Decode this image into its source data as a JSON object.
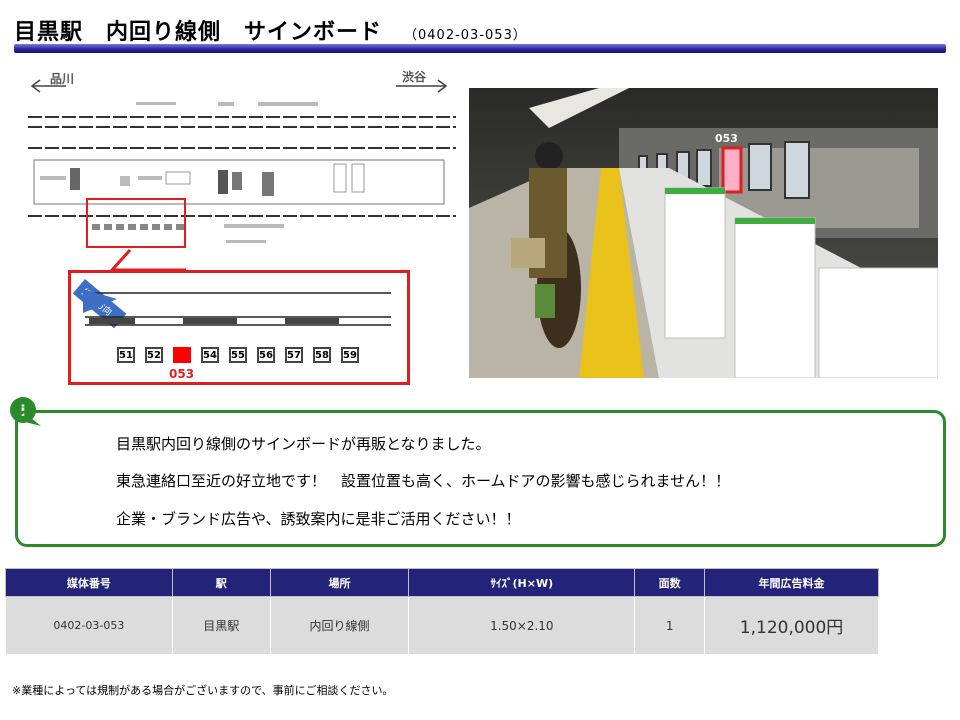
{
  "header": {
    "title": "目黒駅　内回り線側　サインボード",
    "code": "（0402-03-053）",
    "accent_color": "#23237a"
  },
  "map": {
    "left_station": "品川",
    "right_station": "渋谷",
    "direction_label": "撮影方向",
    "boards": [
      "51",
      "52",
      "053",
      "54",
      "55",
      "56",
      "57",
      "58",
      "59"
    ],
    "selected_board": "053",
    "highlight_color": "#e01e1e"
  },
  "photo": {
    "board_label": "053"
  },
  "info": {
    "icon": "info-icon",
    "lines": [
      "目黒駅内回り線側のサインボードが再販となりました。",
      "東急連絡口至近の好立地です！　設置位置も高く、ホームドアの影響も感じられません！！",
      "企業・ブランド広告や、誘致案内に是非ご活用ください！！"
    ]
  },
  "spec_table": {
    "headers": [
      "媒体番号",
      "駅",
      "場所",
      "ｻｲｽﾞ(H×W)",
      "面数",
      "年間広告料金"
    ],
    "row": [
      "0402-03-053",
      "目黒駅",
      "内回り線側",
      "1.50×2.10",
      "1",
      "1,120,000円"
    ]
  },
  "footnote": "※業種によっては規制がある場合がございますので、事前にご相談ください。"
}
